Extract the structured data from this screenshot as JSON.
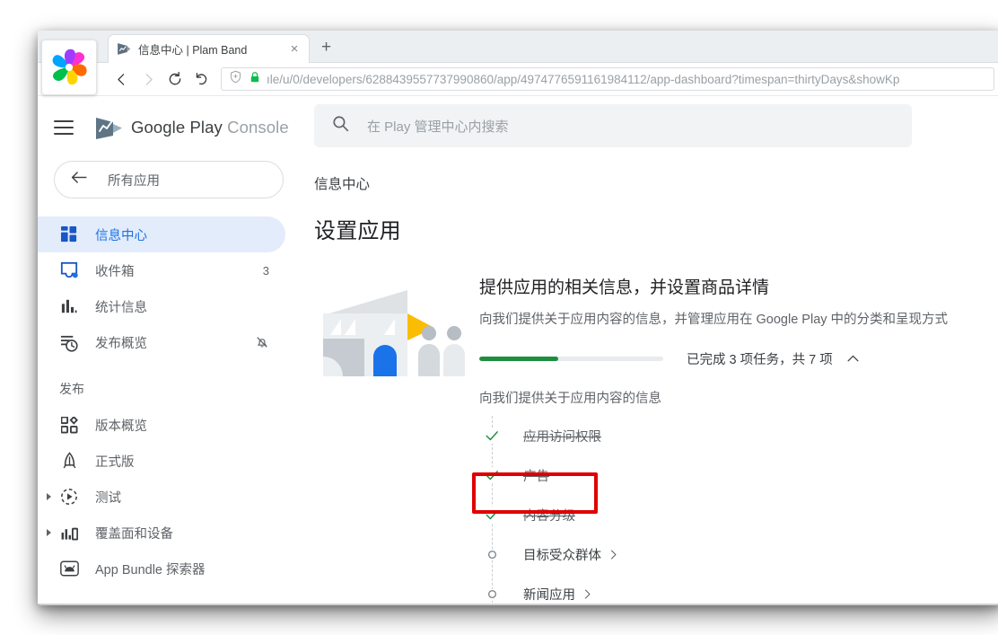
{
  "browser": {
    "logo_icon": "pinwheel-browser-logo",
    "tab": {
      "favicon_icon": "play-console-favicon",
      "title": "信息中心 | Plam Band",
      "close_icon": "×"
    },
    "new_tab_icon": "+",
    "nav": {
      "back_icon": "chevron-left-icon",
      "forward_icon": "chevron-right-icon",
      "reload_icon": "reload-icon",
      "home_icon": "undo-arrow-icon"
    },
    "omnibox": {
      "shield_icon": "shield-icon",
      "lock_icon": "lock-icon",
      "url": "ıle/u/0/developers/6288439557737990860/app/4974776591161984112/app-dashboard?timespan=thirtyDays&showKp"
    }
  },
  "sidebar": {
    "menu_icon": "hamburger-menu-icon",
    "brand": {
      "word1": "Google Play",
      "word2": "Console",
      "logo_icon": "play-console-logo"
    },
    "all_apps": {
      "label": "所有应用",
      "icon": "arrow-left-icon"
    },
    "items": [
      {
        "label": "信息中心",
        "icon": "dashboard-icon",
        "active": true,
        "trailing": "",
        "expandable": false
      },
      {
        "label": "收件箱",
        "icon": "inbox-icon",
        "active": false,
        "trailing": "3",
        "expandable": false
      },
      {
        "label": "统计信息",
        "icon": "statistics-bar-icon",
        "active": false,
        "trailing": "",
        "expandable": false
      },
      {
        "label": "发布概览",
        "icon": "publishing-overview-icon",
        "active": false,
        "trailing": "bell-off-icon",
        "expandable": false
      }
    ],
    "section_label": "发布",
    "publish_items": [
      {
        "label": "版本概览",
        "icon": "release-overview-icon",
        "expandable": false
      },
      {
        "label": "正式版",
        "icon": "production-rocket-icon",
        "expandable": false
      },
      {
        "label": "测试",
        "icon": "testing-icon",
        "expandable": true
      },
      {
        "label": "覆盖面和设备",
        "icon": "reach-devices-icon",
        "expandable": true
      },
      {
        "label": "App Bundle 探索器",
        "icon": "app-bundle-explorer-icon",
        "expandable": false
      }
    ]
  },
  "main": {
    "search": {
      "placeholder": "在 Play 管理中心内搜索",
      "icon": "search-icon"
    },
    "breadcrumb": "信息中心",
    "page_title": "设置应用",
    "card": {
      "illustration_icon": "store-front-illustration",
      "title": "提供应用的相关信息，并设置商品详情",
      "description": "向我们提供关于应用内容的信息，并管理应用在 Google Play 中的分类和呈现方式",
      "progress": {
        "completed": 3,
        "total": 7,
        "percent": 43,
        "text": "已完成 3 项任务，共 7 项",
        "collapse_icon": "chevron-up-icon",
        "fill_color": "#1e8e3e",
        "track_color": "#e8eaed"
      },
      "tasks_heading": "向我们提供关于应用内容的信息",
      "tasks": [
        {
          "label": "应用访问权限",
          "done": true,
          "marker": "check-icon",
          "chevron": false
        },
        {
          "label": "广告",
          "done": true,
          "marker": "check-icon",
          "chevron": false
        },
        {
          "label": "内容分级",
          "done": true,
          "marker": "check-icon",
          "chevron": false,
          "highlighted": true
        },
        {
          "label": "目标受众群体",
          "done": false,
          "marker": "circle-icon",
          "chevron": true
        },
        {
          "label": "新闻应用",
          "done": false,
          "marker": "circle-icon",
          "chevron": true
        }
      ]
    }
  },
  "annotation": {
    "highlight_color": "#e00000",
    "target": "内容分级"
  }
}
